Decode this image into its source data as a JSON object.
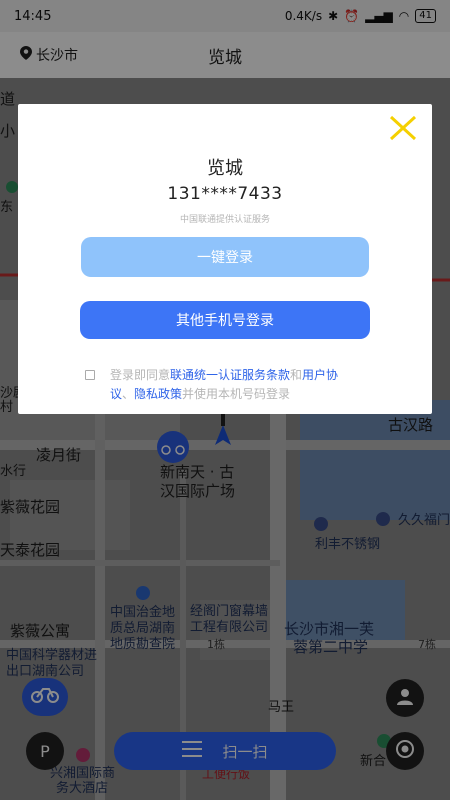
{
  "status_bar": {
    "time": "14:45",
    "network_speed": "0.4K/s",
    "battery": "41"
  },
  "top_bar": {
    "city": "长沙市",
    "title": "览城"
  },
  "map_labels": {
    "road1": "凌月街",
    "road2": "古汉路",
    "poi_main": "新南天 · 古",
    "poi_main2": "汉国际广场",
    "garden1": "紫薇花园",
    "garden2": "天泰花园",
    "apartment": "紫薇公寓",
    "inst1": "中国治金地",
    "inst2": "质总局湖南",
    "inst3": "地质勘查院",
    "inst4": "中国科学器材进",
    "inst5": "出口湖南公司",
    "mgmt1": "经阁门窗幕墙",
    "mgmt2": "工程有限公司",
    "school1": "长沙市湘一芙",
    "school2": "蓉第二中学",
    "steel": "利丰不锈钢",
    "fortune": "久久福门",
    "hotel1": "兴湘国际商",
    "hotel2": "务大酒店",
    "workshop": "工便行饭",
    "ma_wang": "马王",
    "xinhe": "新合",
    "tower1": "1栋",
    "tower7": "7栋",
    "shui": "水行",
    "left1": "道",
    "left2": "小",
    "left3": "东",
    "left4": "沙剧",
    "left5": "村"
  },
  "bottom": {
    "scan_label": "扫一扫",
    "parking_label": "P"
  },
  "dialog": {
    "title": "览城",
    "phone": "131****7433",
    "provider": "中国联通提供认证服务",
    "onekey_label": "一键登录",
    "other_label": "其他手机号登录",
    "agree_prefix": "登录即同意",
    "agree_link1": "联通统一认证服务条款",
    "agree_and": "和",
    "agree_link2": "用户协议",
    "agree_sep": "、",
    "agree_link3": "隐私政策",
    "agree_suffix": "并使用本机号码登录"
  },
  "colors": {
    "accent": "#3d75f6",
    "onekey_bg": "#8fc3fb",
    "close_icon": "#f5d000",
    "link": "#2e63e8"
  }
}
